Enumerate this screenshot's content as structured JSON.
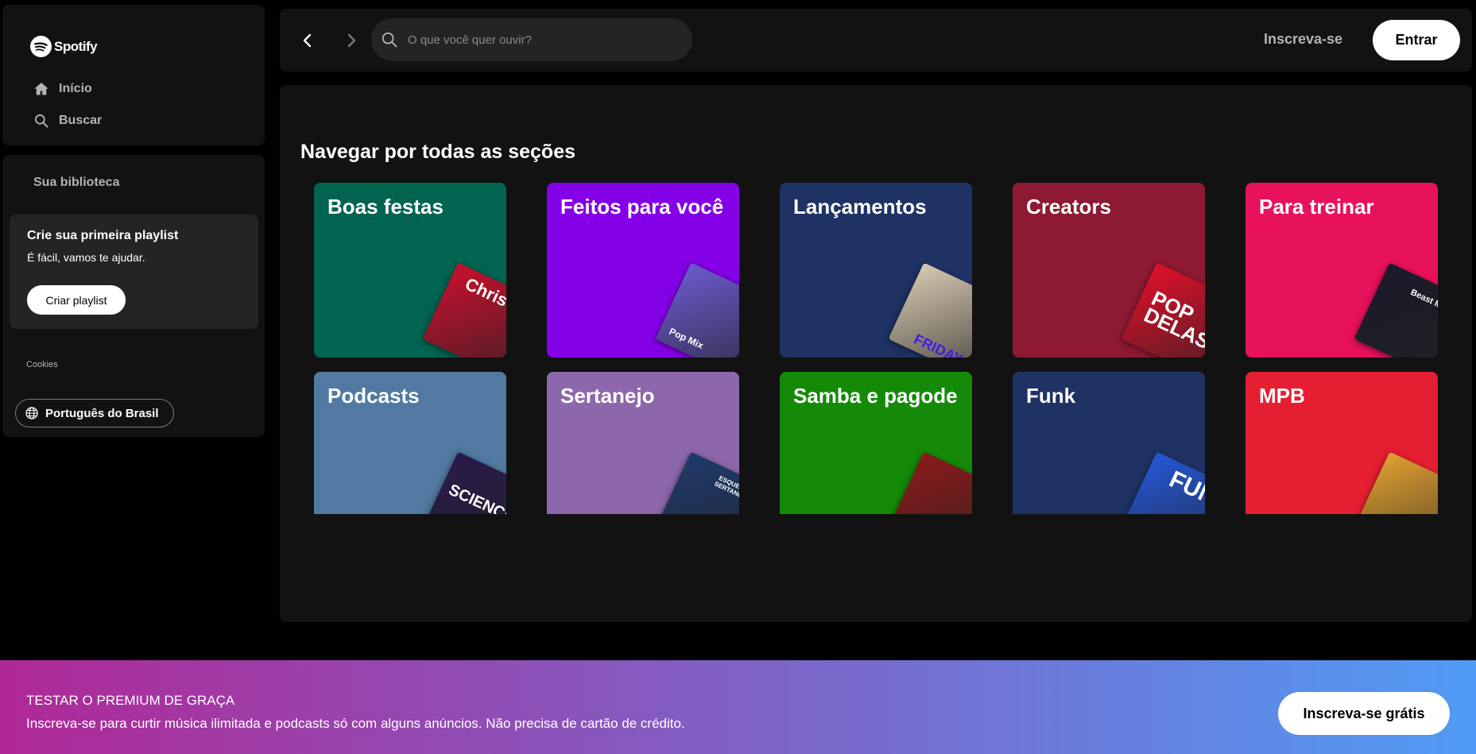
{
  "brand": {
    "name": "Spotify",
    "accent": "#1ed760"
  },
  "nav": {
    "home": "Início",
    "search": "Buscar"
  },
  "library": {
    "title": "Sua biblioteca",
    "promo_title": "Crie sua primeira playlist",
    "promo_subtitle": "É fácil, vamos te ajudar.",
    "promo_button": "Criar playlist",
    "cookies": "Cookies",
    "language": "Português do Brasil"
  },
  "topbar": {
    "search_placeholder": "O que você quer ouvir?",
    "signup": "Inscreva-se",
    "login": "Entrar"
  },
  "main": {
    "title": "Navegar por todas as seções",
    "cards": [
      {
        "label": "Boas festas",
        "color": "#006450",
        "art_color": "#c8102e",
        "art_text": "Christmas Hits"
      },
      {
        "label": "Feitos para você",
        "color": "#8400e7",
        "art_color": "#6a5acd",
        "art_text": "Pop Mix"
      },
      {
        "label": "Lançamentos",
        "color": "#1e3264",
        "art_color": "#d7c8b0",
        "art_text": "FRIDAY"
      },
      {
        "label": "Creators",
        "color": "#8d1932",
        "art_color": "#e0102a",
        "art_text": "POP DELAS"
      },
      {
        "label": "Para treinar",
        "color": "#e8115b",
        "art_color": "#1a1a2a",
        "art_text": "Beast Mode"
      },
      {
        "label": "Podcasts",
        "color": "#5179a1",
        "art_color": "#2a1a4a",
        "art_text": "SCIENCE"
      },
      {
        "label": "Sertanejo",
        "color": "#8d67ab",
        "art_color": "#1f3a6b",
        "art_text": "ESQUENTA SERTANEJO"
      },
      {
        "label": "Samba e pagode",
        "color": "#148a08",
        "art_color": "#8b1a1a",
        "art_text": ""
      },
      {
        "label": "Funk",
        "color": "#1e3264",
        "art_color": "#2457d6",
        "art_text": "FUNK"
      },
      {
        "label": "MPB",
        "color": "#e61e32",
        "art_color": "#e0a030",
        "art_text": ""
      }
    ]
  },
  "banner": {
    "title": "TESTAR O PREMIUM DE GRAÇA",
    "text": "Inscreva-se para curtir música ilimitada e podcasts só com alguns anúncios. Não precisa de cartão de crédito.",
    "button": "Inscreva-se grátis"
  }
}
